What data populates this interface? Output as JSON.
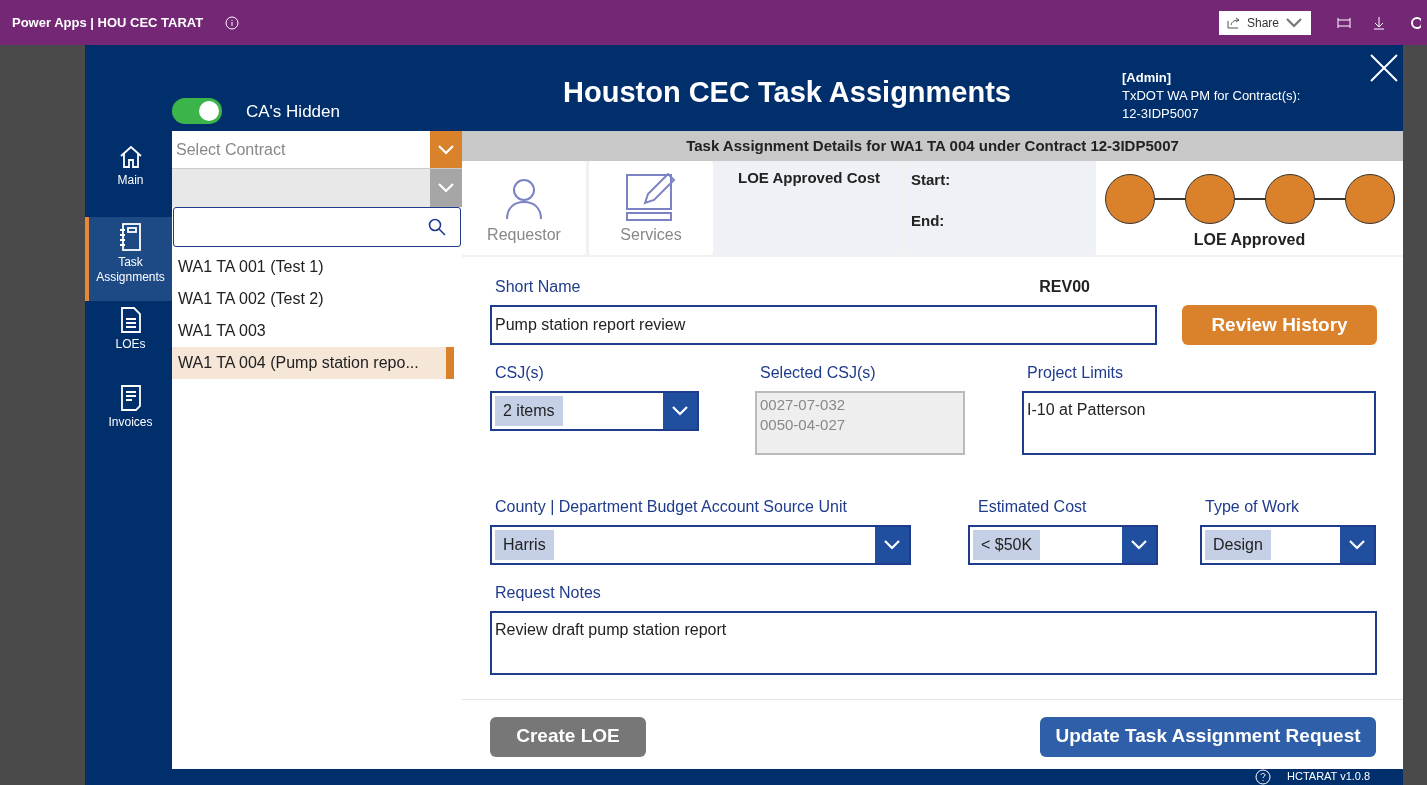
{
  "topbar": {
    "app_title": "Power Apps | HOU CEC TARAT",
    "share_label": "Share"
  },
  "header": {
    "toggle": {
      "label": "CA's Hidden",
      "on": true
    },
    "title": "Houston CEC Task Assignments",
    "role": "[Admin]",
    "user_lines": [
      "TxDOT WA PM for Contract(s):",
      "12-3IDP5007"
    ]
  },
  "nav": [
    {
      "kind": "home",
      "label": "Main",
      "selected": false
    },
    {
      "kind": "notebook",
      "label": "Task Assignments",
      "selected": true
    },
    {
      "kind": "document",
      "label": "LOEs",
      "selected": false
    },
    {
      "kind": "invoice",
      "label": "Invoices",
      "selected": false
    }
  ],
  "contract_select": {
    "placeholder": "Select Contract"
  },
  "task_list": [
    {
      "label": "WA1 TA 001 (Test 1)",
      "selected": false
    },
    {
      "label": "WA1 TA 002 (Test 2)",
      "selected": false
    },
    {
      "label": "WA1 TA 003",
      "selected": false
    },
    {
      "label": "WA1 TA 004 (Pump station repo...",
      "selected": true
    }
  ],
  "details": {
    "title": "Task Assignment Details for WA1 TA 004 under Contract 12-3IDP5007",
    "tiles": [
      {
        "kind": "person",
        "label": "Requestor"
      },
      {
        "kind": "edit",
        "label": "Services"
      }
    ],
    "cost_label": "LOE Approved Cost",
    "start_label": "Start:",
    "end_label": "End:",
    "status": {
      "label": "LOE Approved",
      "steps": [
        {
          "done": true
        },
        {
          "done": true
        },
        {
          "done": true
        },
        {
          "done": true
        }
      ]
    }
  },
  "form": {
    "short_name": {
      "label": "Short Name",
      "value": "Pump station report review"
    },
    "revision": "REV00",
    "review_button": "Review History",
    "csj": {
      "label": "CSJ(s)",
      "value": "2 items"
    },
    "selected_csj": {
      "label": "Selected CSJ(s)",
      "values": [
        "0027-07-032",
        "0050-04-027"
      ]
    },
    "project_limits": {
      "label": "Project Limits",
      "value": "I-10 at Patterson"
    },
    "county": {
      "label": "County | Department Budget Account Source Unit",
      "value": "Harris"
    },
    "estimated_cost": {
      "label": "Estimated Cost",
      "value": "< $50K"
    },
    "type_of_work": {
      "label": "Type of Work",
      "value": "Design"
    },
    "request_notes": {
      "label": "Request Notes",
      "value": "Review draft pump station report"
    },
    "create_button": "Create LOE",
    "update_button": "Update Task Assignment Request"
  },
  "footer": {
    "version": "HCTARAT v1.0.8"
  }
}
